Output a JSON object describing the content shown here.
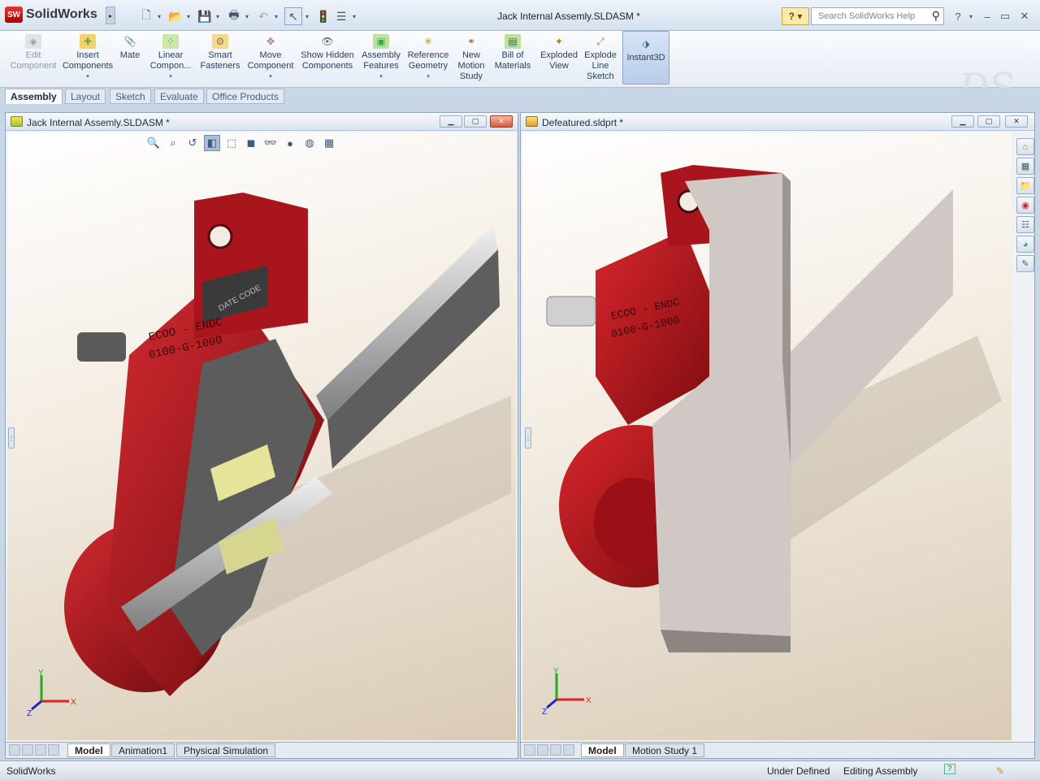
{
  "app": {
    "name": "SolidWorks",
    "window_title": "Jack Internal Assemly.SLDASM *"
  },
  "search": {
    "placeholder": "Search SolidWorks Help"
  },
  "help_label": "?",
  "ribbon": [
    {
      "name": "edit-component",
      "label": "Edit Component",
      "disabled": true
    },
    {
      "name": "insert-components",
      "label": "Insert Components"
    },
    {
      "name": "mate",
      "label": "Mate"
    },
    {
      "name": "linear-component-pattern",
      "label": "Linear Compon..."
    },
    {
      "name": "smart-fasteners",
      "label": "Smart Fasteners"
    },
    {
      "name": "move-component",
      "label": "Move Component"
    },
    {
      "name": "show-hidden-components",
      "label": "Show Hidden Components"
    },
    {
      "name": "assembly-features",
      "label": "Assembly Features"
    },
    {
      "name": "reference-geometry",
      "label": "Reference Geometry"
    },
    {
      "name": "new-motion-study",
      "label": "New Motion Study"
    },
    {
      "name": "bill-of-materials",
      "label": "Bill of Materials"
    },
    {
      "name": "exploded-view",
      "label": "Exploded View"
    },
    {
      "name": "explode-line-sketch",
      "label": "Explode Line Sketch"
    },
    {
      "name": "instant3d",
      "label": "Instant3D",
      "active": true
    }
  ],
  "tabs": [
    "Assembly",
    "Layout",
    "Sketch",
    "Evaluate",
    "Office Products"
  ],
  "left_pane": {
    "title": "Jack Internal Assemly.SLDASM *",
    "tabs": [
      "Model",
      "Animation1",
      "Physical Simulation"
    ],
    "model_text": {
      "label1": "ECOO - ENDC",
      "label2": "0100-G-1000",
      "label3": "DATE CODE"
    }
  },
  "right_pane": {
    "title": "Defeatured.sldprt *",
    "tabs": [
      "Model",
      "Motion Study 1"
    ],
    "model_text": {
      "label1": "ECOO - ENDC",
      "label2": "0100-G-1000"
    }
  },
  "triad": {
    "x": "X",
    "y": "Y",
    "z": "Z"
  },
  "status": {
    "app": "SolidWorks",
    "state": "Under Defined",
    "mode": "Editing Assembly"
  },
  "colors": {
    "accent_red": "#a8151c",
    "ribbon_bg": "#e4ecf6",
    "active_button": "#b9cde9"
  }
}
